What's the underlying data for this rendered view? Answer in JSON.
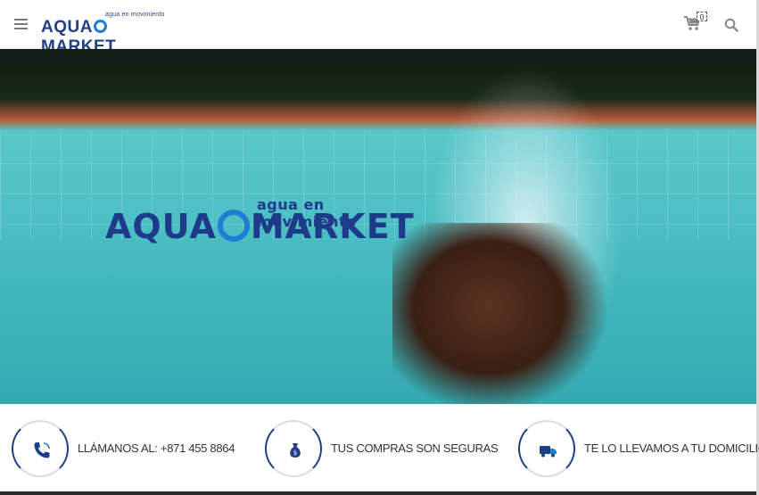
{
  "header": {
    "logo_tagline": "agua en movimiento",
    "logo_text_left": "AQUA",
    "logo_text_right": "MARKET",
    "cart_count": "0"
  },
  "hero": {
    "logo_tagline": "agua en movimiento",
    "logo_text_left": "AQUA",
    "logo_text_right": "MARKET"
  },
  "features": [
    {
      "label": "LLÁMANOS AL: +871 455 8864",
      "icon": "phone-icon"
    },
    {
      "label": "TUS COMPRAS SON SEGURAS",
      "icon": "money-bag-icon"
    },
    {
      "label": "TE LO LLEVAMOS A TU DOMICILIO",
      "icon": "delivery-truck-icon"
    }
  ],
  "colors": {
    "brand_blue": "#1f3f87",
    "accent_blue": "#1e7fd0"
  }
}
